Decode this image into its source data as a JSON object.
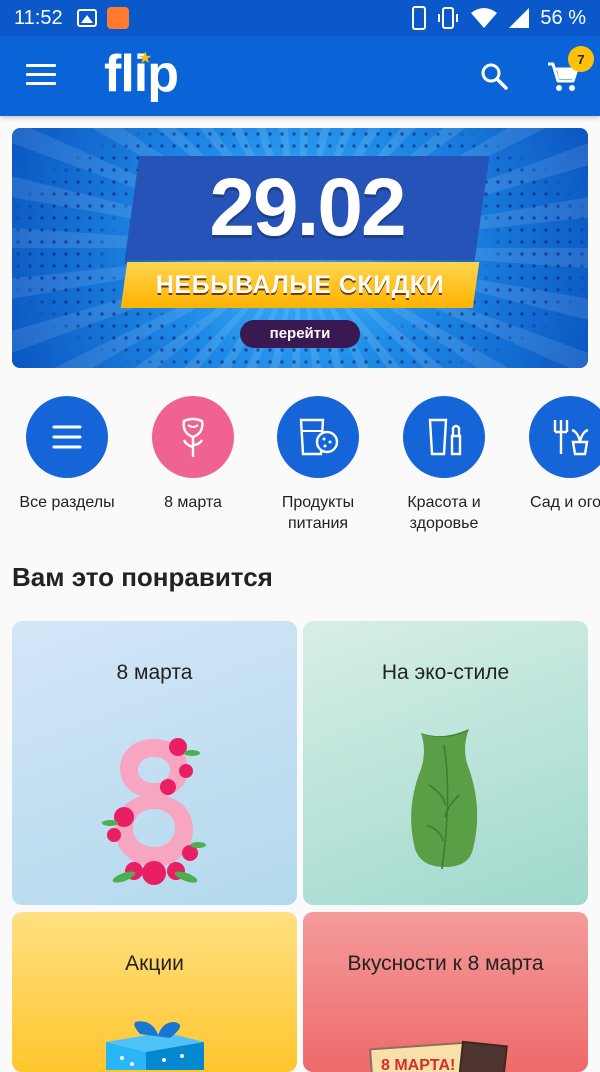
{
  "status_bar": {
    "time": "11:52",
    "battery": "56 %",
    "icons": [
      "image-icon",
      "app-notification-icon",
      "phone-icon",
      "vibrate-icon",
      "wifi-icon",
      "signal-icon",
      "battery-icon"
    ]
  },
  "app_bar": {
    "logo": "flip",
    "cart_count": "7",
    "colors": {
      "primary": "#0a64d8",
      "badge": "#ffc107"
    }
  },
  "banner": {
    "date": "29.02",
    "headline": "НЕБЫВАЛЫЕ СКИДКИ",
    "button": "перейти"
  },
  "categories": [
    {
      "label": "Все разделы",
      "icon": "list-icon",
      "color": "#1565d8"
    },
    {
      "label": "8 марта",
      "icon": "rose-icon",
      "color": "#f06292"
    },
    {
      "label": "Продукты питания",
      "icon": "food-icon",
      "color": "#1565d8"
    },
    {
      "label": "Красота и здоровье",
      "icon": "cosmetics-icon",
      "color": "#1565d8"
    },
    {
      "label": "Сад и огор",
      "icon": "garden-icon",
      "color": "#1565d8"
    }
  ],
  "section": {
    "title": "Вам это понравится"
  },
  "tiles": [
    {
      "title": "8 марта"
    },
    {
      "title": "На эко-стиле"
    },
    {
      "title": "Акции"
    },
    {
      "title": "Вкусности к 8 марта"
    }
  ],
  "tile_images": {
    "sign_text": "8 МАРТА!"
  }
}
